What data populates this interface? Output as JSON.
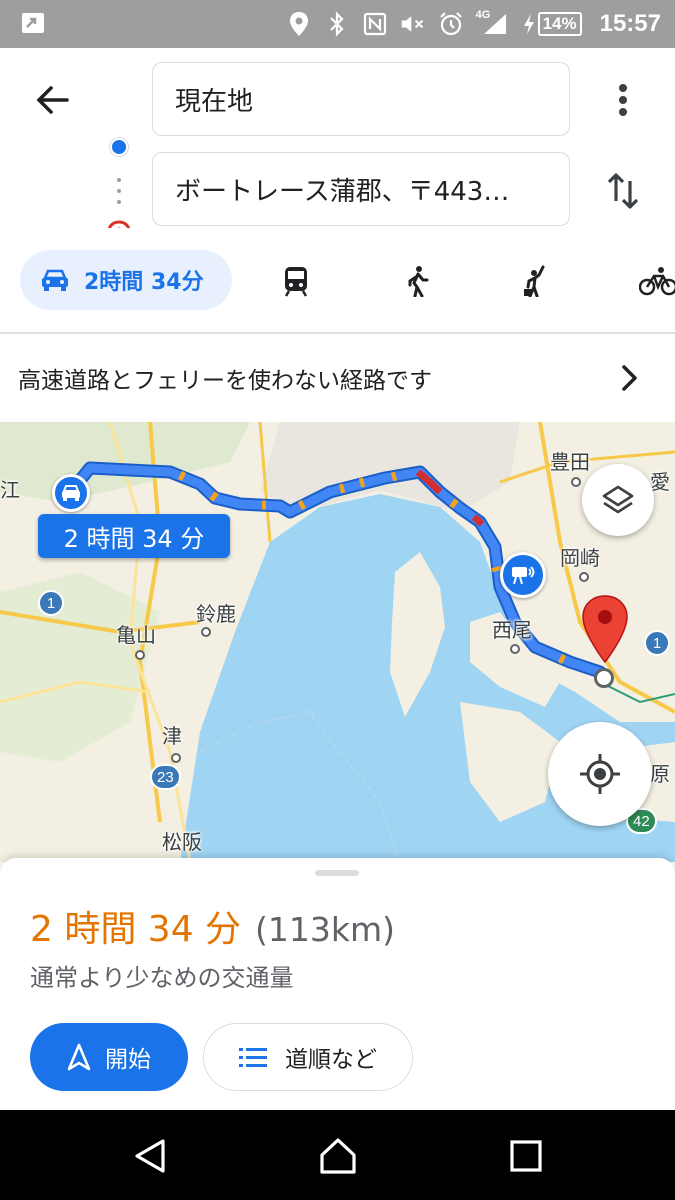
{
  "status_bar": {
    "battery": "14%",
    "network": "4G",
    "time": "15:57"
  },
  "directions": {
    "origin_value": "現在地",
    "destination_value": "ボートレース蒲郡、〒443…"
  },
  "modes": {
    "drive_label": "2時間 34分",
    "items": [
      "car-icon",
      "transit-icon",
      "walk-icon",
      "ride-hailing-icon",
      "bicycle-icon"
    ]
  },
  "notice": {
    "text": "高速道路とフェリーを使わない経路です"
  },
  "map": {
    "eta_bubble": "2 時間 34 分",
    "labels": {
      "toyota": "豊田",
      "okazaki": "岡崎",
      "kameyama": "亀山",
      "suzuka": "鈴鹿",
      "nishio": "西尾",
      "tsu": "津",
      "matsusaka": "松阪",
      "ai": "愛",
      "hara": "原",
      "edge_e": "江"
    },
    "route_shields": {
      "r1_left": "1",
      "r1_right": "1",
      "r23": "23",
      "r42": "42"
    },
    "colors": {
      "water": "#9fd4f3",
      "land": "#f3efe2",
      "route": "#4285f4",
      "route_outline": "#1a5fc8",
      "traffic_slow": "#f4a21c",
      "traffic_jam": "#d32f2f"
    }
  },
  "summary": {
    "duration": "2 時間 34 分",
    "distance": "(113km)",
    "traffic": "通常より少なめの交通量",
    "start_label": "開始",
    "steps_label": "道順など"
  }
}
